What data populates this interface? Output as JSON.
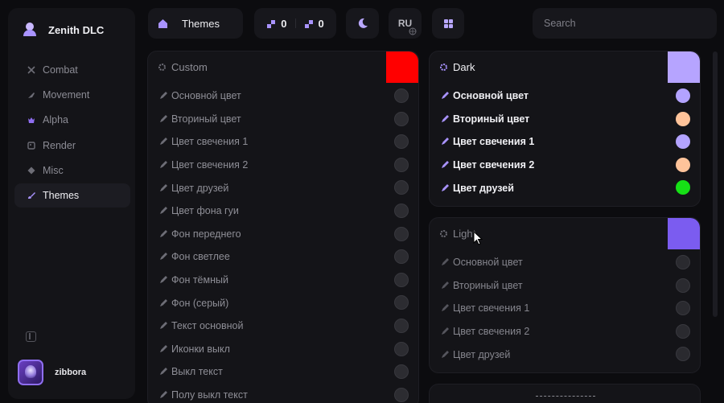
{
  "app": {
    "name": "Zenith DLC"
  },
  "sidebar": {
    "items": [
      {
        "label": "Combat",
        "icon": "crossed-swords-icon"
      },
      {
        "label": "Movement",
        "icon": "feather-icon"
      },
      {
        "label": "Alpha",
        "icon": "crown-icon"
      },
      {
        "label": "Render",
        "icon": "image-icon"
      },
      {
        "label": "Misc",
        "icon": "diamond-icon"
      },
      {
        "label": "Themes",
        "icon": "brush-icon",
        "active": true
      }
    ]
  },
  "user": {
    "name": "zibbora"
  },
  "topbar": {
    "title": "Themes",
    "count_a": "0",
    "count_b": "0",
    "lang": "RU",
    "search_placeholder": "Search"
  },
  "themes": {
    "custom": {
      "name": "Custom",
      "accent": "#ff0000",
      "rows": [
        "Основной цвет",
        "Вториный цвет",
        "Цвет свечения 1",
        "Цвет свечения 2",
        "Цвет друзей",
        "Цвет фона гуи",
        "Фон переднего",
        "Фон светлее",
        "Фон тёмный",
        "Фон (серый)",
        "Текст основной",
        "Иконки выкл",
        "Выкл текст",
        "Полу выкл текст"
      ]
    },
    "dark": {
      "name": "Dark",
      "accent": "#b6a4ff",
      "rows": [
        {
          "label": "Основной цвет",
          "color": "#b3a3ff"
        },
        {
          "label": "Вториный цвет",
          "color": "#ffc39a"
        },
        {
          "label": "Цвет свечения 1",
          "color": "#b3a3ff"
        },
        {
          "label": "Цвет свечения 2",
          "color": "#ffc39a"
        },
        {
          "label": "Цвет друзей",
          "color": "#16e016"
        }
      ]
    },
    "light": {
      "name": "Light",
      "accent": "#7b5cf0",
      "rows": [
        "Основной цвет",
        "Вториный цвет",
        "Цвет свечения 1",
        "Цвет свечения 2",
        "Цвет друзей"
      ]
    }
  },
  "colors": {
    "accent_purple": "#8f6ef0",
    "background": "#0c0c0f",
    "panel": "#141418"
  }
}
